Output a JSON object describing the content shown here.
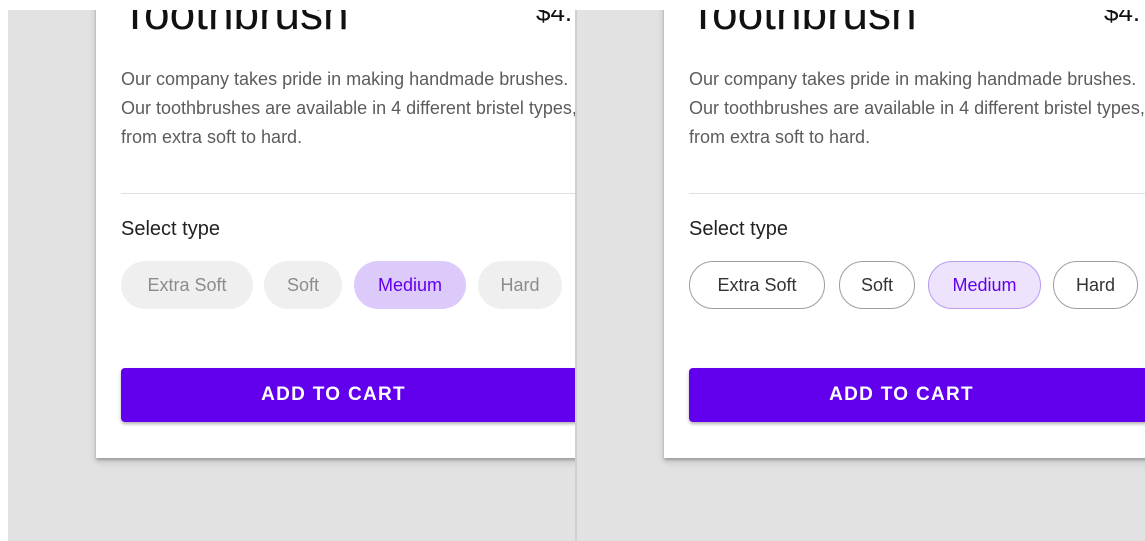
{
  "product": {
    "title": "Toothbrush",
    "price": "$4.",
    "description": "Our company takes pride in making handmade brushes. Our toothbrushes are available in 4 different bristel types, from extra soft to hard."
  },
  "type_selector": {
    "label": "Select type",
    "options": [
      "Extra Soft",
      "Soft",
      "Medium",
      "Hard"
    ],
    "selected": "Medium"
  },
  "actions": {
    "add_to_cart": "ADD TO CART"
  },
  "variants": [
    "filled-chips",
    "outlined-chips"
  ],
  "colors": {
    "primary": "#6200ee",
    "selected_chip_bg_filled": "#dccafb",
    "selected_chip_bg_outlined": "#ede3fd",
    "chip_bg_filled": "#efefef",
    "background": "#e2e2e2"
  }
}
